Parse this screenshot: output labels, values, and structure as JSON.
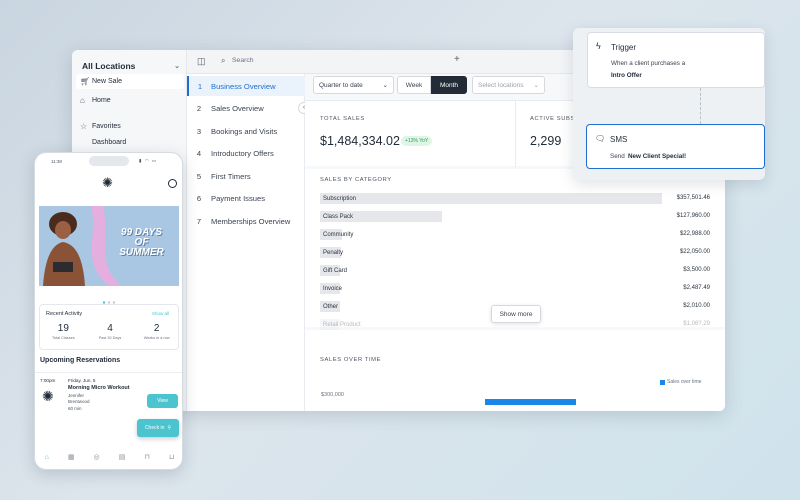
{
  "sidebar": {
    "location": "All Locations",
    "items": [
      {
        "label": "New Sale",
        "icon": "cart-icon"
      },
      {
        "label": "Home",
        "icon": "home-icon"
      },
      {
        "label": "Favorites",
        "icon": "star-icon"
      },
      {
        "label": "Dashboard",
        "icon": ""
      }
    ]
  },
  "topbar": {
    "search_placeholder": "Search"
  },
  "reports": [
    {
      "num": "1",
      "label": "Business Overview"
    },
    {
      "num": "2",
      "label": "Sales Overview"
    },
    {
      "num": "3",
      "label": "Bookings and Visits"
    },
    {
      "num": "4",
      "label": "Introductory Offers"
    },
    {
      "num": "5",
      "label": "First Timers"
    },
    {
      "num": "6",
      "label": "Payment Issues"
    },
    {
      "num": "7",
      "label": "Memberships Overview"
    }
  ],
  "filters": {
    "period": "Quarter to date",
    "week": "Week",
    "month": "Month",
    "locations_placeholder": "Select locations"
  },
  "kpis": {
    "total_label": "TOTAL SALES",
    "total_value": "$1,484,334.02",
    "total_badge": "+13% YoY",
    "active_label": "ACTIVE SUBSC",
    "active_value": "2,299"
  },
  "category": {
    "title": "SALES BY CATEGORY",
    "show_more": "Show more",
    "rows": [
      {
        "label": "Subscription",
        "value": "$357,501.46",
        "amount": 357501.46
      },
      {
        "label": "Class Pack",
        "value": "$127,960.00",
        "amount": 127960.0
      },
      {
        "label": "Community",
        "value": "$22,988.00",
        "amount": 22988.0
      },
      {
        "label": "Penalty",
        "value": "$22,050.00",
        "amount": 22050.0
      },
      {
        "label": "Gift Card",
        "value": "$3,500.00",
        "amount": 3500.0
      },
      {
        "label": "Invoice",
        "value": "$2,487.49",
        "amount": 2487.49
      },
      {
        "label": "Other",
        "value": "$2,010.00",
        "amount": 2010.0
      },
      {
        "label": "Retail Product",
        "value": "$1,06?.29",
        "amount": 1060
      }
    ]
  },
  "time": {
    "title": "SALES OVER TIME",
    "legend": "Sales over time",
    "y_tick": "$300,000"
  },
  "flow": {
    "trigger_title": "Trigger",
    "trigger_text": "When a client purchases a",
    "trigger_bold": "Intro Offer",
    "sms_title": "SMS",
    "sms_text": "Send",
    "sms_bold": "New Client Special!"
  },
  "phone": {
    "time": "11:38",
    "banner_line1": "99 DAYS",
    "banner_line2": "OF",
    "banner_line3": "SUMMER",
    "activity_title": "Recent Activity",
    "show_all": "Show all",
    "stats": [
      {
        "v": "19",
        "c": "Total Classes"
      },
      {
        "v": "4",
        "c": "Past 30 Days"
      },
      {
        "v": "2",
        "c": "Weeks in a row"
      }
    ],
    "reservations_title": "Upcoming Reservations",
    "res": {
      "time": "7:00pm",
      "date": "Friday, Jun. 5",
      "name": "Morning Micro Workout",
      "instructor": "Jennifer",
      "location": "Brentwood",
      "duration": "60 min",
      "view": "View"
    },
    "checkin": "Check in"
  },
  "colors": {
    "accent": "#1f6fd0",
    "teal": "#4cc4cf",
    "bar": "#1a86e8"
  }
}
